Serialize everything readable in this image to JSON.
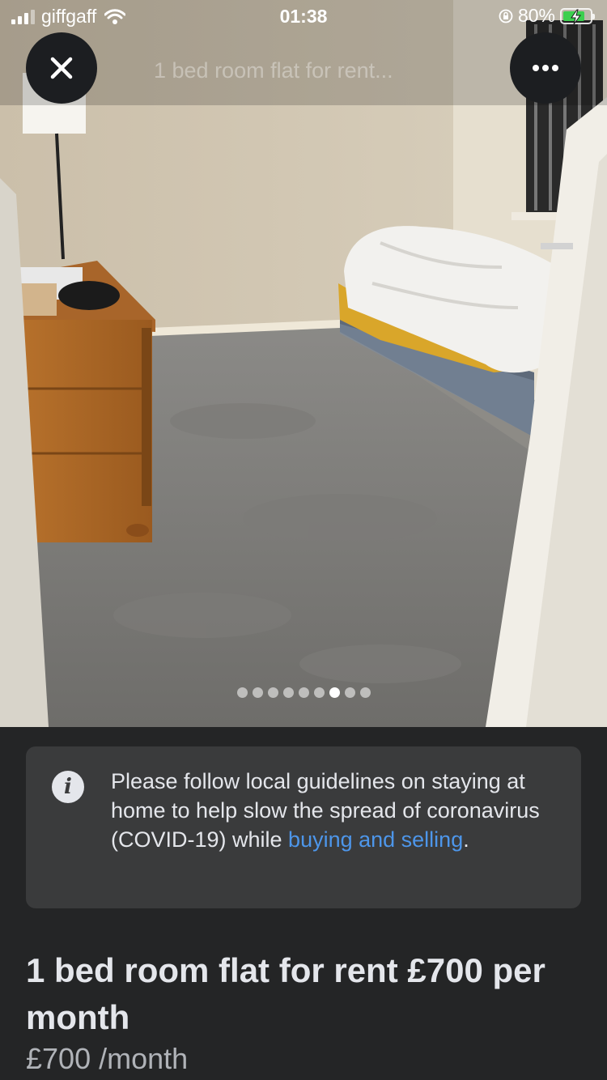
{
  "status_bar": {
    "carrier": "giffgaff",
    "time": "01:38",
    "battery_percent": "80%",
    "battery_level": 0.8
  },
  "header": {
    "overlay_title": "1 bed room flat for rent..."
  },
  "gallery": {
    "total_images": 9,
    "current_index": 6
  },
  "notice": {
    "text": "Please follow local guidelines on staying at home to help slow the spread of coronavirus (COVID-19) while ",
    "link_text": "buying and selling",
    "end_punct": ".",
    "link_color": "#4d96ea"
  },
  "listing": {
    "title": "1 bed room flat for rent £700 per month",
    "price": "£700",
    "price_unit": " /month"
  },
  "icons": {
    "close": "close-icon",
    "more": "more-dots-icon",
    "info": "info-icon"
  }
}
